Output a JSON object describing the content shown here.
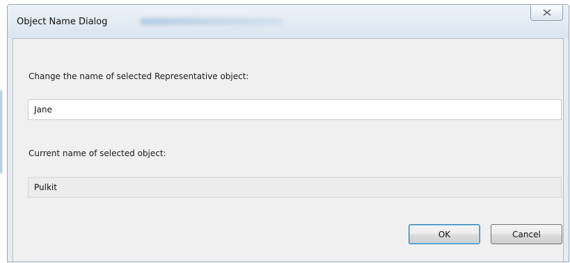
{
  "dialog": {
    "title": "Object Name Dialog",
    "close_icon": "close-x-icon"
  },
  "form": {
    "new_name_label": "Change the name of selected Representative object:",
    "new_name_value": "Jane",
    "current_name_label": "Current name of selected object:",
    "current_name_value": "Pulkit"
  },
  "buttons": {
    "ok_label": "OK",
    "cancel_label": "Cancel"
  },
  "colors": {
    "titlebar": "#dbe5ef",
    "client_background": "#f0f0f0",
    "default_button_focus": "#78c3f0"
  }
}
